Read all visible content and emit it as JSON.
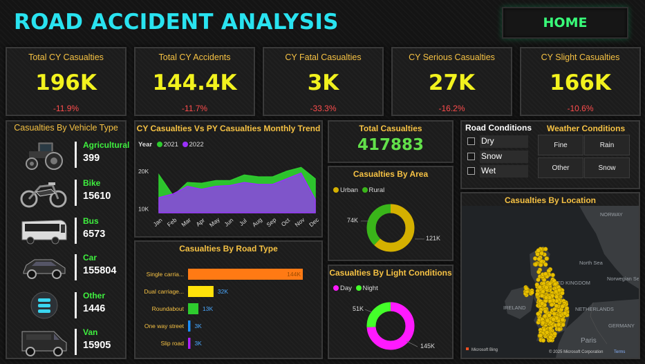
{
  "header": {
    "title": "ROAD ACCIDENT ANALYSIS",
    "home_label": "HOME"
  },
  "kpis": [
    {
      "label": "Total CY Casualties",
      "value": "196K",
      "change": "-11.9%"
    },
    {
      "label": "Total CY Accidents",
      "value": "144.4K",
      "change": "-11.7%"
    },
    {
      "label": "CY Fatal Casualties",
      "value": "3K",
      "change": "-33.3%"
    },
    {
      "label": "CY Serious Casualties",
      "value": "27K",
      "change": "-16.2%"
    },
    {
      "label": "CY Slight Casualties",
      "value": "166K",
      "change": "-10.6%"
    }
  ],
  "vehicles": {
    "title": "Casualties By Vehicle Type",
    "items": [
      {
        "name": "Agricultural",
        "value": "399",
        "icon": "tractor-icon"
      },
      {
        "name": "Bike",
        "value": "15610",
        "icon": "motorbike-icon"
      },
      {
        "name": "Bus",
        "value": "6573",
        "icon": "bus-icon"
      },
      {
        "name": "Car",
        "value": "155804",
        "icon": "car-icon"
      },
      {
        "name": "Other",
        "value": "1446",
        "icon": "other-icon"
      },
      {
        "name": "Van",
        "value": "15905",
        "icon": "van-icon"
      }
    ]
  },
  "trend": {
    "title": "CY Casualties Vs PY Casualties Monthly Trend",
    "legend_title": "Year",
    "series_names": [
      "2021",
      "2022"
    ],
    "colors": [
      "#2ecc2e",
      "#9b30ff"
    ],
    "y_ticks": [
      "20K",
      "10K"
    ]
  },
  "total_casualties": {
    "label": "Total Casualties",
    "value": "417883"
  },
  "road_conditions": {
    "title": "Road Conditions",
    "options": [
      "Dry",
      "Snow",
      "Wet"
    ]
  },
  "weather": {
    "title": "Weather Conditions",
    "options": [
      "Fine",
      "Rain",
      "Other",
      "Snow"
    ]
  },
  "area": {
    "title": "Casualties By Area",
    "legend": [
      "Urban",
      "Rural"
    ],
    "labels": [
      "121K",
      "74K"
    ],
    "colors": [
      "#d4b000",
      "#3ab51a"
    ]
  },
  "light": {
    "title": "Casualties By Light Conditions",
    "legend": [
      "Day",
      "Night"
    ],
    "labels": [
      "145K",
      "51K"
    ],
    "colors": [
      "#ff1aff",
      "#44ff2a"
    ]
  },
  "road_type": {
    "title": "Casualties By Road Type",
    "colors": [
      "#ff7a14",
      "#ffe20a",
      "#2ecc2e",
      "#1a8fff",
      "#b020ff"
    ]
  },
  "location": {
    "title": "Casualties By Location",
    "map_labels": [
      "NORWAY",
      "North Sea",
      "UNITED KINGDOM",
      "IRELAND",
      "NETHERLANDS",
      "GERMANY",
      "Paris",
      "Norwegian Sea"
    ],
    "bing_label": "Microsoft Bing",
    "copyright": "© 2025 Microsoft Corporation",
    "terms": "Terms"
  },
  "chart_data": [
    {
      "type": "area",
      "title": "CY Casualties Vs PY Casualties Monthly Trend",
      "categories": [
        "Jan",
        "Feb",
        "Mar",
        "Apr",
        "May",
        "Jun",
        "Jul",
        "Aug",
        "Sep",
        "Oct",
        "Nov",
        "Dec"
      ],
      "series": [
        {
          "name": "2021",
          "values": [
            19000,
            13500,
            17000,
            16800,
            17500,
            17500,
            19000,
            18500,
            18500,
            20000,
            21000,
            18000
          ]
        },
        {
          "name": "2022",
          "values": [
            13000,
            14000,
            16000,
            15200,
            16000,
            16200,
            17000,
            16500,
            16500,
            18000,
            19500,
            12500
          ]
        }
      ],
      "ylim": [
        9000,
        24000
      ]
    },
    {
      "type": "bar",
      "title": "Casualties By Road Type",
      "categories": [
        "Single carria...",
        "Dual carriage...",
        "Roundabout",
        "One way street",
        "Slip road"
      ],
      "values": [
        144,
        32,
        13,
        3,
        3
      ],
      "labels": [
        "144K",
        "32K",
        "13K",
        "3K",
        "3K"
      ]
    },
    {
      "type": "pie",
      "title": "Casualties By Area",
      "categories": [
        "Urban",
        "Rural"
      ],
      "values": [
        121,
        74
      ]
    },
    {
      "type": "pie",
      "title": "Casualties By Light Conditions",
      "categories": [
        "Day",
        "Night"
      ],
      "values": [
        145,
        51
      ]
    }
  ]
}
